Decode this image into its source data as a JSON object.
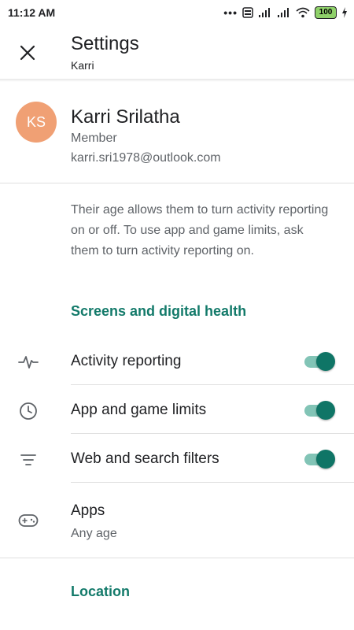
{
  "status_bar": {
    "time": "11:12 AM",
    "battery": "100"
  },
  "header": {
    "title": "Settings",
    "subtitle": "Karri"
  },
  "profile": {
    "initials": "KS",
    "name": "Karri Srilatha",
    "role": "Member",
    "email": "karri.sri1978@outlook.com"
  },
  "info_text": "Their age allows them to turn activity reporting on or off. To use app and game limits, ask them to turn activity reporting on.",
  "sections": {
    "screens": "Screens and digital health",
    "location": "Location"
  },
  "rows": [
    {
      "label": "Activity reporting",
      "icon": "activity-icon",
      "toggle": "on"
    },
    {
      "label": "App and game limits",
      "icon": "clock-icon",
      "toggle": "on"
    },
    {
      "label": "Web and search filters",
      "icon": "filter-icon",
      "toggle": "on"
    },
    {
      "label": "Apps",
      "sublabel": "Any age",
      "icon": "gamepad-icon"
    }
  ],
  "colors": {
    "accent": "#137a6a",
    "toggle_thumb": "#0f7566",
    "toggle_track": "#82c4b6",
    "avatar": "#f0a074"
  }
}
